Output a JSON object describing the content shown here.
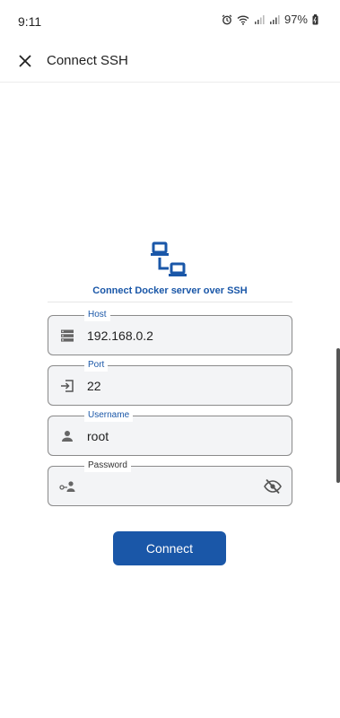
{
  "status_bar": {
    "time": "9:11",
    "battery": "97%"
  },
  "app_bar": {
    "title": "Connect SSH",
    "close_icon": "close-icon"
  },
  "hero": {
    "icon": "network-icon",
    "title": "Connect Docker server over SSH"
  },
  "form": {
    "host": {
      "label": "Host",
      "value": "192.168.0.2",
      "icon": "server-icon"
    },
    "port": {
      "label": "Port",
      "value": "22",
      "icon": "login-icon"
    },
    "username": {
      "label": "Username",
      "value": "root",
      "icon": "person-icon"
    },
    "password": {
      "label": "Password",
      "value": "",
      "icon": "key-person-icon",
      "toggle_icon": "visibility-off-icon"
    }
  },
  "actions": {
    "connect_label": "Connect"
  },
  "colors": {
    "accent": "#1a57a8",
    "field_bg": "#f3f4f6",
    "field_border": "#8a8a8a"
  }
}
